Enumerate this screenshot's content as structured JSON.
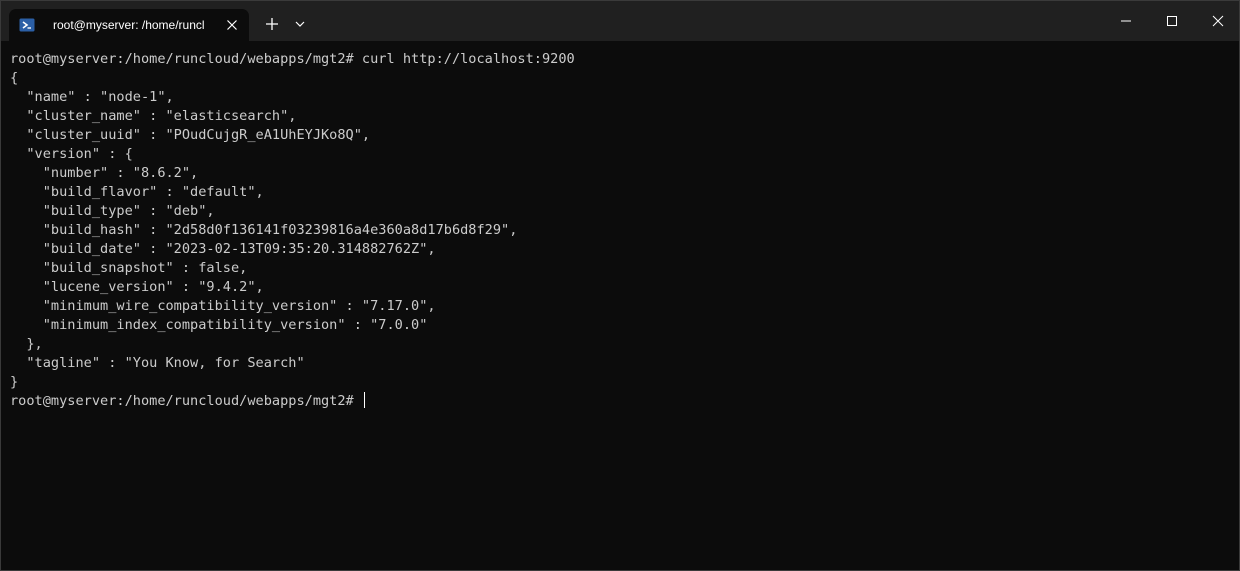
{
  "tab": {
    "title": "root@myserver: /home/runclo",
    "icon": "powershell-icon"
  },
  "window_controls": {
    "minimize_icon": "minimize-icon",
    "maximize_icon": "maximize-icon",
    "close_icon": "close-icon"
  },
  "terminal": {
    "lines": [
      "root@myserver:/home/runcloud/webapps/mgt2# curl http://localhost:9200",
      "{",
      "  \"name\" : \"node-1\",",
      "  \"cluster_name\" : \"elasticsearch\",",
      "  \"cluster_uuid\" : \"POudCujgR_eA1UhEYJKo8Q\",",
      "  \"version\" : {",
      "    \"number\" : \"8.6.2\",",
      "    \"build_flavor\" : \"default\",",
      "    \"build_type\" : \"deb\",",
      "    \"build_hash\" : \"2d58d0f136141f03239816a4e360a8d17b6d8f29\",",
      "    \"build_date\" : \"2023-02-13T09:35:20.314882762Z\",",
      "    \"build_snapshot\" : false,",
      "    \"lucene_version\" : \"9.4.2\",",
      "    \"minimum_wire_compatibility_version\" : \"7.17.0\",",
      "    \"minimum_index_compatibility_version\" : \"7.0.0\"",
      "  },",
      "  \"tagline\" : \"You Know, for Search\"",
      "}"
    ],
    "prompt": "root@myserver:/home/runcloud/webapps/mgt2# "
  },
  "colors": {
    "background": "#0c0c0c",
    "titlebar": "#202020",
    "text": "#cccccc",
    "tab_icon": "#2b5fa6"
  }
}
